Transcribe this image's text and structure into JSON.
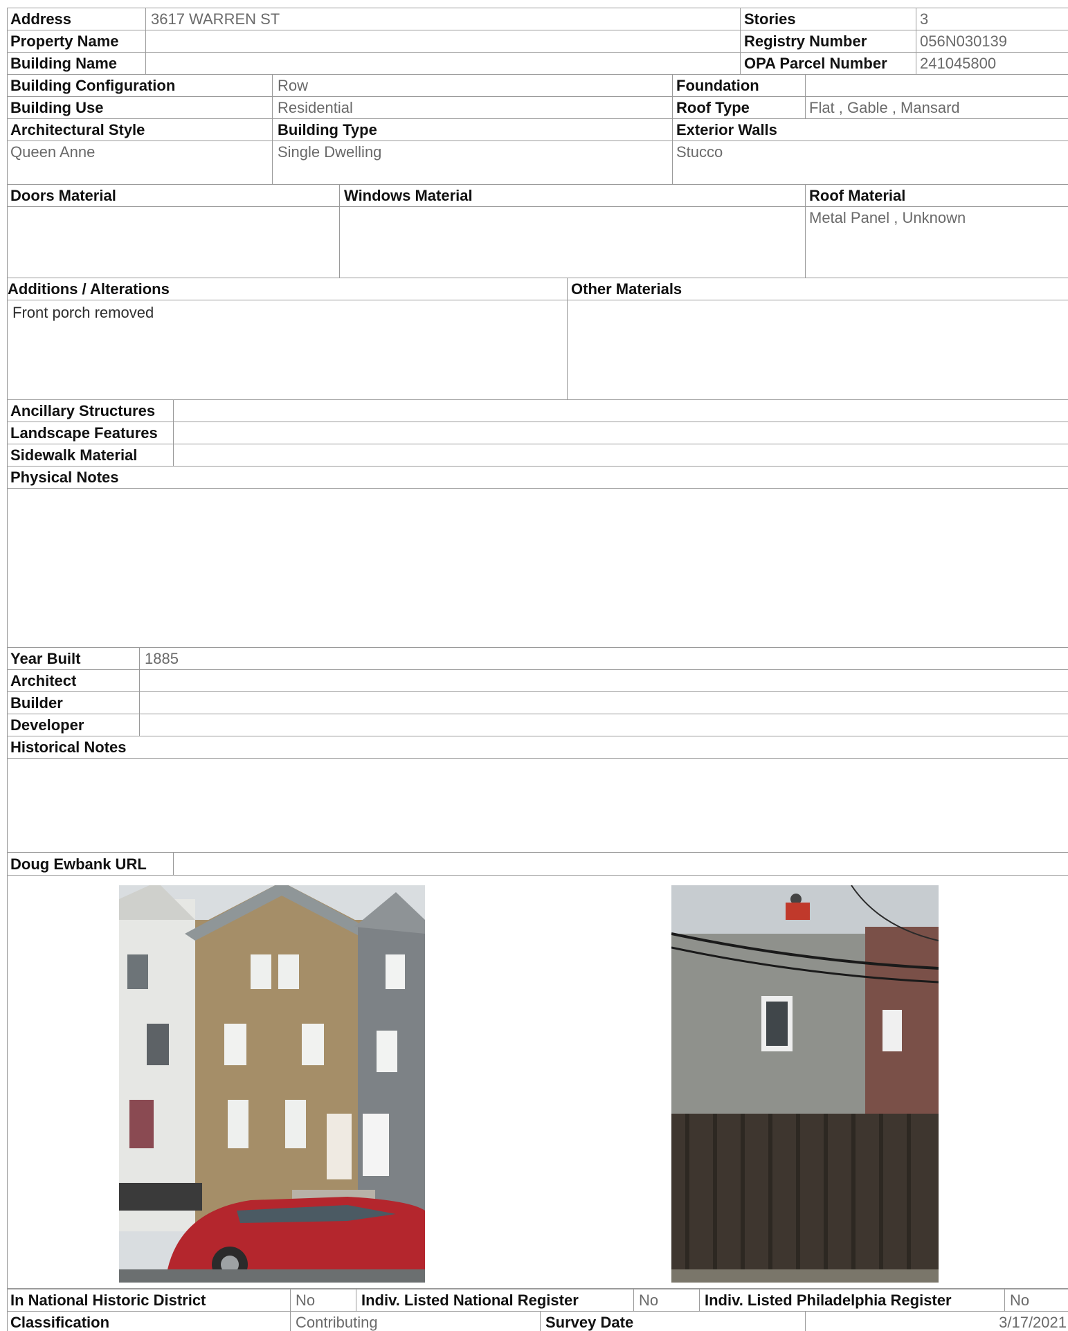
{
  "identity": {
    "address_label": "Address",
    "address": "3617 WARREN ST",
    "property_name_label": "Property Name",
    "property_name": "",
    "building_name_label": "Building Name",
    "building_name": "",
    "stories_label": "Stories",
    "stories": "3",
    "registry_label": "Registry Number",
    "registry": "056N030139",
    "opa_label": "OPA Parcel Number",
    "opa": "241045800"
  },
  "building": {
    "config_label": "Building Configuration",
    "config": "Row",
    "use_label": "Building Use",
    "use": "Residential",
    "arch_style_label": "Architectural Style",
    "arch_style": "Queen Anne",
    "type_label": "Building Type",
    "type": "Single Dwelling",
    "foundation_label": "Foundation",
    "foundation": "",
    "roof_type_label": "Roof Type",
    "roof_type": "Flat , Gable , Mansard",
    "ext_walls_label": "Exterior Walls",
    "ext_walls": "Stucco"
  },
  "materials": {
    "doors_label": "Doors Material",
    "doors": "",
    "windows_label": "Windows Material",
    "windows": "",
    "roof_label": "Roof Material",
    "roof": "Metal Panel , Unknown"
  },
  "alterations": {
    "label": "Additions / Alterations",
    "value": "Front porch removed",
    "other_label": "Other Materials",
    "other": ""
  },
  "site": {
    "ancillary_label": "Ancillary Structures",
    "ancillary": "",
    "landscape_label": "Landscape Features",
    "landscape": "",
    "sidewalk_label": "Sidewalk Material",
    "sidewalk": "",
    "physical_notes_label": "Physical Notes",
    "physical_notes": ""
  },
  "history": {
    "year_label": "Year Built",
    "year": "1885",
    "architect_label": "Architect",
    "architect": "",
    "builder_label": "Builder",
    "builder": "",
    "developer_label": "Developer",
    "developer": "",
    "notes_label": "Historical Notes",
    "notes": ""
  },
  "url": {
    "label": "Doug Ewbank URL",
    "value": ""
  },
  "photos": [
    {
      "name": "front-facade-photo",
      "subject": "front facade with red car"
    },
    {
      "name": "rear-facade-photo",
      "subject": "rear stucco wall behind wooden fence"
    }
  ],
  "register": {
    "nhd_label": "In National Historic District",
    "nhd": "No",
    "national_label": "Indiv. Listed National Register",
    "national": "No",
    "phila_label": "Indiv. Listed Philadelphia Register",
    "phila": "No",
    "class_label": "Classification",
    "class": "Contributing",
    "survey_label": "Survey Date",
    "survey": "3/17/2021"
  }
}
